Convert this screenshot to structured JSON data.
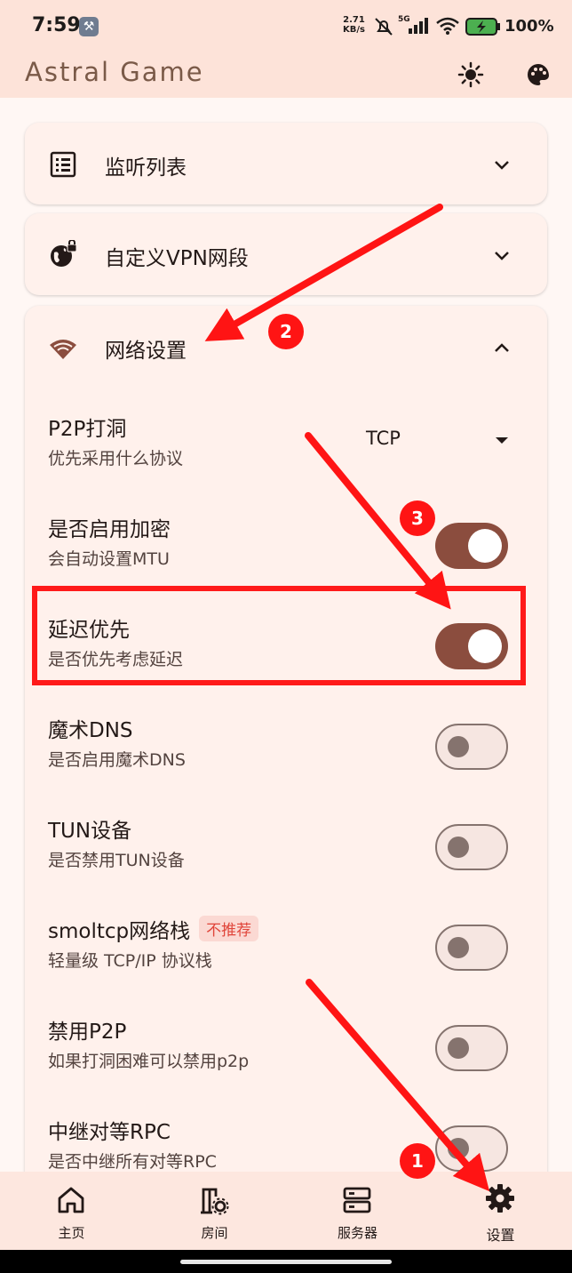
{
  "status_bar": {
    "time": "7:59",
    "net_speed_value": "2.71",
    "net_speed_unit": "KB/s",
    "network_type": "5G",
    "battery_percent": "100%"
  },
  "app_bar": {
    "title": "Astral Game",
    "theme_icon": "sun-icon",
    "palette_icon": "palette-icon"
  },
  "cards": {
    "listen_list": {
      "title": "监听列表",
      "icon": "list-icon",
      "expanded": false
    },
    "custom_vpn": {
      "title": "自定义VPN网段",
      "icon": "globe-lock-icon",
      "expanded": false
    },
    "network": {
      "title": "网络设置",
      "icon": "wifi-icon",
      "expanded": true
    }
  },
  "network_settings": {
    "p2p": {
      "title": "P2P打洞",
      "subtitle": "优先采用什么协议",
      "value": "TCP"
    },
    "encryption": {
      "title": "是否启用加密",
      "subtitle": "会自动设置MTU",
      "enabled": true
    },
    "latency_first": {
      "title": "延迟优先",
      "subtitle": "是否优先考虑延迟",
      "enabled": true
    },
    "magic_dns": {
      "title": "魔术DNS",
      "subtitle": "是否启用魔术DNS",
      "enabled": false
    },
    "tun": {
      "title": "TUN设备",
      "subtitle": "是否禁用TUN设备",
      "enabled": false
    },
    "smoltcp": {
      "title": "smoltcp网络栈",
      "tag": "不推荐",
      "subtitle": "轻量级 TCP/IP 协议栈",
      "enabled": false
    },
    "disable_p2p": {
      "title": "禁用P2P",
      "subtitle": "如果打洞困难可以禁用p2p",
      "enabled": false
    },
    "relay_rpc": {
      "title": "中继对等RPC",
      "subtitle": "是否中继所有对等RPC",
      "enabled": false
    }
  },
  "annotations": {
    "badge_1": "1",
    "badge_2": "2",
    "badge_3": "3",
    "color": "#ff1414"
  },
  "bottom_nav": {
    "home": "主页",
    "rooms": "房间",
    "servers": "服务器",
    "settings": "设置",
    "active": "settings"
  },
  "colors": {
    "primary": "#8b4d3e",
    "surface": "#fff7f4",
    "appbar": "#fde3d9",
    "card": "#fff1ec"
  }
}
